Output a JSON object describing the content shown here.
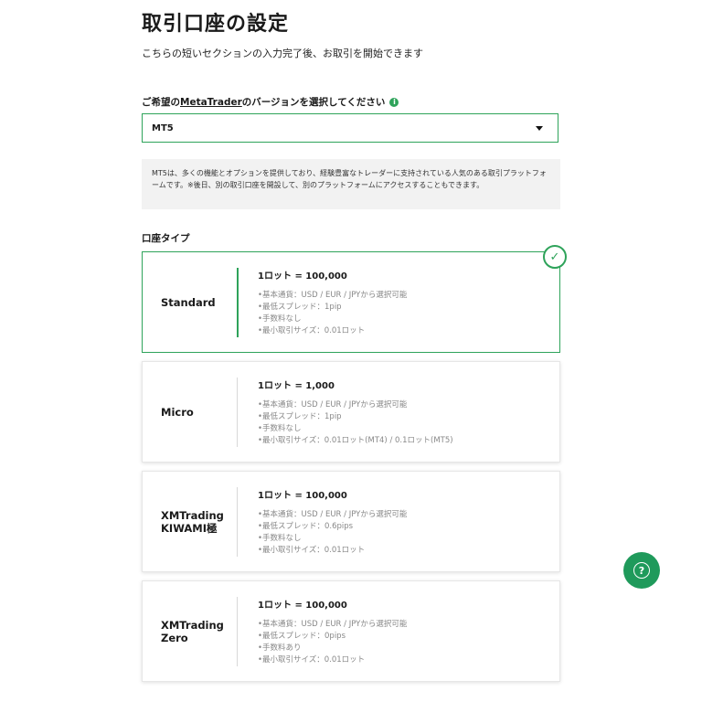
{
  "header": {
    "title": "取引口座の設定",
    "subtitle": "こちらの短いセクションの入力完了後、お取引を開始できます"
  },
  "platform": {
    "label_prefix": "ご希望の",
    "label_link": "MetaTrader",
    "label_suffix": "のバージョンを選択してください",
    "info_icon": "i",
    "selected": "MT5",
    "description": "MT5は、多くの機能とオプションを提供しており、経験豊富なトレーダーに支持されている人気のある取引プラットフォームです。※後日、別の取引口座を開設して、別のプラットフォームにアクセスすることもできます。"
  },
  "account_type": {
    "label": "口座タイプ",
    "cards": [
      {
        "name": "Standard",
        "lot": "1ロット = 100,000",
        "features": [
          "•基本通貨：USD / EUR / JPYから選択可能",
          "•最低スプレッド：1pip",
          "•手数料なし",
          "•最小取引サイズ：0.01ロット"
        ],
        "selected": true
      },
      {
        "name": "Micro",
        "lot": "1ロット = 1,000",
        "features": [
          "•基本通貨：USD / EUR / JPYから選択可能",
          "•最低スプレッド：1pip",
          "•手数料なし",
          "•最小取引サイズ：0.01ロット(MT4) / 0.1ロット(MT5)"
        ],
        "selected": false
      },
      {
        "name": "XMTrading KIWAMI極",
        "lot": "1ロット = 100,000",
        "features": [
          "•基本通貨：USD / EUR / JPYから選択可能",
          "•最低スプレッド：0.6pips",
          "•手数料なし",
          "•最小取引サイズ：0.01ロット"
        ],
        "selected": false
      },
      {
        "name": "XMTrading Zero",
        "lot": "1ロット = 100,000",
        "features": [
          "•基本通貨：USD / EUR / JPYから選択可能",
          "•最低スプレッド：0pips",
          "•手数料あり",
          "•最小取引サイズ：0.01ロット"
        ],
        "selected": false
      }
    ]
  },
  "colors": {
    "accent": "#2ea35a",
    "help_button": "#1f9a5b"
  },
  "icons": {
    "selected": "checkmark-icon",
    "help": "question-icon",
    "dropdown": "chevron-down-icon"
  }
}
